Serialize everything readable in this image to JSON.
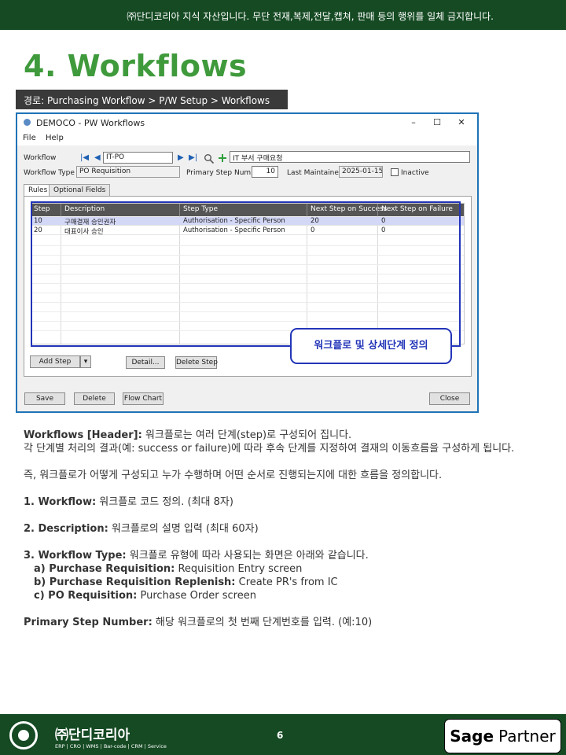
{
  "banner": {
    "text": "㈜단디코리아 지식 자산입니다. 무단 전재,복제,전달,캡쳐, 판매 등의 행위를 일체 금지합니다."
  },
  "page_title": "4. Workflows",
  "route": "경로: Purchasing Workflow > P/W Setup > Workflows",
  "window": {
    "title": "DEMOCO - PW Workflows",
    "controls": {
      "minimize": "–",
      "maximize": "☐",
      "close": "✕"
    },
    "menu": [
      "File",
      "Help"
    ],
    "form": {
      "workflow_label": "Workflow",
      "workflow_value": "IT-PO",
      "workflow_desc": "IT 부서 구매요청",
      "workflow_type_label": "Workflow Type",
      "workflow_type_value": "PO Requisition",
      "primary_step_label": "Primary Step Number",
      "primary_step_value": "10",
      "last_maintained_label": "Last Maintained",
      "last_maintained_value": "2025-01-15",
      "inactive_label": "Inactive"
    },
    "tabs": [
      "Rules",
      "Optional Fields"
    ],
    "grid": {
      "headers": [
        "Step",
        "Description",
        "Step Type",
        "Next Step on Success",
        "Next Step on Failure"
      ],
      "rows": [
        {
          "step": "10",
          "description": "구매결재 승인권자",
          "step_type": "Authorisation - Specific Person",
          "next_success": "20",
          "next_failure": "0"
        },
        {
          "step": "20",
          "description": "대표이사 승인",
          "step_type": "Authorisation - Specific Person",
          "next_success": "0",
          "next_failure": "0"
        }
      ]
    },
    "callout": "워크플로 및 상세단계 정의",
    "buttons": {
      "add_step": "Add Step",
      "add_step_dropdown": "▾",
      "detail": "Detail...",
      "delete_step": "Delete Step",
      "save": "Save",
      "delete": "Delete",
      "flow_chart": "Flow Chart",
      "close": "Close"
    }
  },
  "body": {
    "header_bold": "Workflows [Header]:",
    "header_text": " 워크플로는 여러 단계(step)로 구성되어 집니다.",
    "line2": "각 단계별 처리의 결과(예: success or failure)에 따라 후속 단계를 지정하여 결재의 이동흐름을 구성하게 됩니다.",
    "line3": "즉, 워크플로가 어떻게 구성되고 누가 수행하며 어떤 순서로 진행되는지에 대한 흐름을 정의합니다.",
    "item1_bold": "1.   Workflow:",
    "item1_text": " 워크플로 코드 정의. (최대 8자)",
    "item2_bold": "2.   Description:",
    "item2_text": " 워크플로의 설명 입력 (최대 60자)",
    "item3_bold": "3.   Workflow Type:",
    "item3_text": " 워크플로 유형에 따라 사용되는 화면은 아래와 같습니다.",
    "sub_a_bold": "a) Purchase Requisition:",
    "sub_a_text": " Requisition Entry screen",
    "sub_b_bold": "b) Purchase Requisition Replenish:",
    "sub_b_text": " Create PR's from IC",
    "sub_c_bold": "c) PO Requisition:",
    "sub_c_text": " Purchase Order screen",
    "primary_bold": "Primary Step Number:",
    "primary_text": " 해당 워크플로의 첫 번째 단계번호를 입력. (예:10)"
  },
  "footer": {
    "brand": "㈜단디코리아",
    "brand_sub": "ERP | CRO | WMS | Bar-code | CRM | Service",
    "page_number": "6",
    "partner_sage": "Sage",
    "partner_text": "Partner"
  },
  "colors": {
    "banner_bg": "#154a23",
    "title_green": "#3f9a3c",
    "route_bg": "#3a3a3a",
    "frame_blue": "#1f73b7",
    "callout_blue": "#2235b8",
    "selected_row": "#d4d8f7"
  }
}
